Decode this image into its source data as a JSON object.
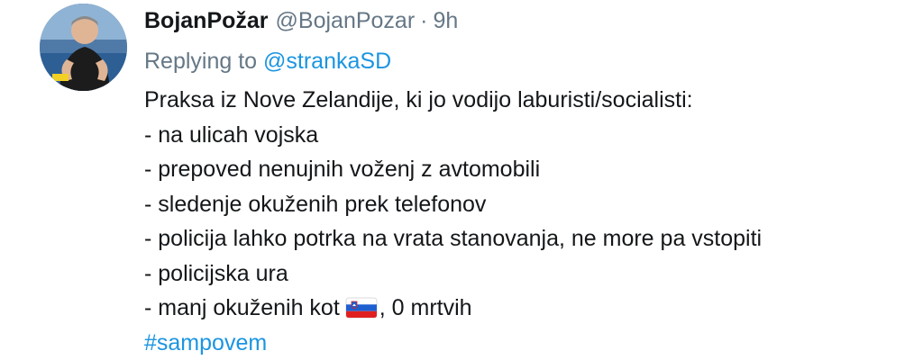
{
  "author": {
    "display_name": "BojanPožar",
    "handle": "@BojanPozar",
    "separator": "·",
    "time": "9h"
  },
  "reply": {
    "prefix": "Replying to",
    "mention": "@stranka​SD"
  },
  "body": {
    "lines": [
      "Praksa iz Nove Zelandije, ki jo vodijo laburisti/socialisti:",
      "- na ulicah vojska",
      "- prepoved nenujnih voženj z avtomobili",
      "- sledenje okuženih prek telefonov",
      "- policija lahko potrka na vrata stanovanja, ne more pa vstopiti",
      "- policijska ura"
    ],
    "last_line_before_flag": "- manj okuženih kot",
    "last_line_after_flag": ", 0 mrtvih",
    "flag_icon": "slovenia-flag-icon",
    "hashtag": "#sampovem"
  },
  "colors": {
    "text": "#14171a",
    "muted": "#657786",
    "link": "#1b95e0"
  }
}
